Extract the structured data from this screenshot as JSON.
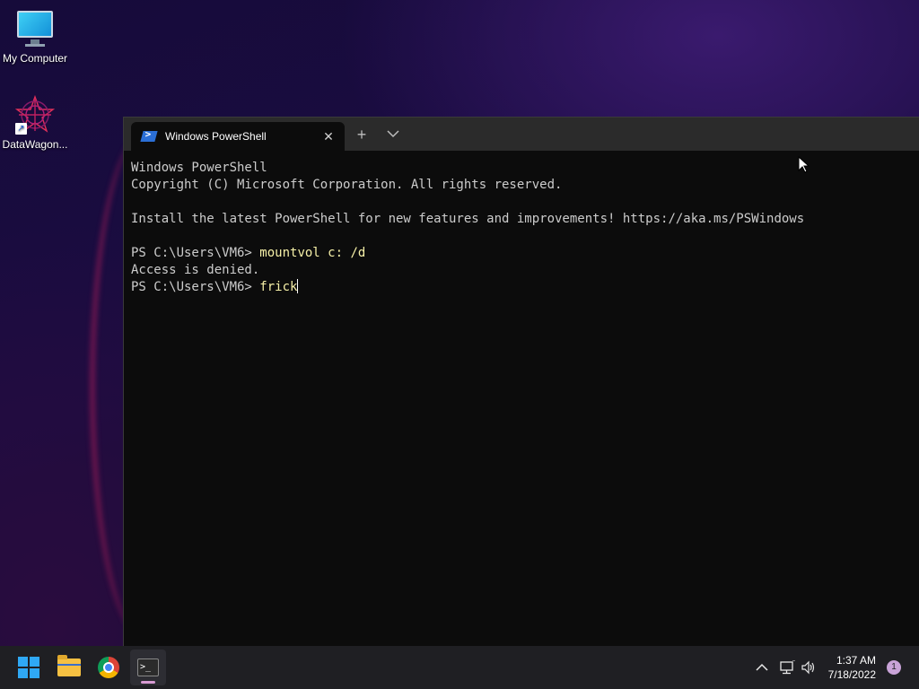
{
  "desktop": {
    "icons": [
      {
        "label": "My Computer",
        "icon": "monitor-icon"
      },
      {
        "label": "DataWagon...",
        "icon": "datawagon-icon"
      }
    ]
  },
  "terminal": {
    "tab_title": "Windows PowerShell",
    "tab_icon": "powershell-icon",
    "lines": {
      "l1": "Windows PowerShell",
      "l2": "Copyright (C) Microsoft Corporation. All rights reserved.",
      "l3": "Install the latest PowerShell for new features and improvements! https://aka.ms/PSWindows",
      "prompt1": "PS C:\\Users\\VM6> ",
      "cmd1": "mountvol c: /d",
      "out1": "Access is denied.",
      "prompt2": "PS C:\\Users\\VM6> ",
      "cmd2": "frick"
    },
    "new_tab_symbol": "+",
    "dropdown_symbol": "⌵"
  },
  "taskbar": {
    "apps": [
      "start-icon",
      "file-explorer-icon",
      "chrome-icon",
      "terminal-icon"
    ],
    "time": "1:37 AM",
    "date": "7/18/2022",
    "notification_count": "1"
  }
}
